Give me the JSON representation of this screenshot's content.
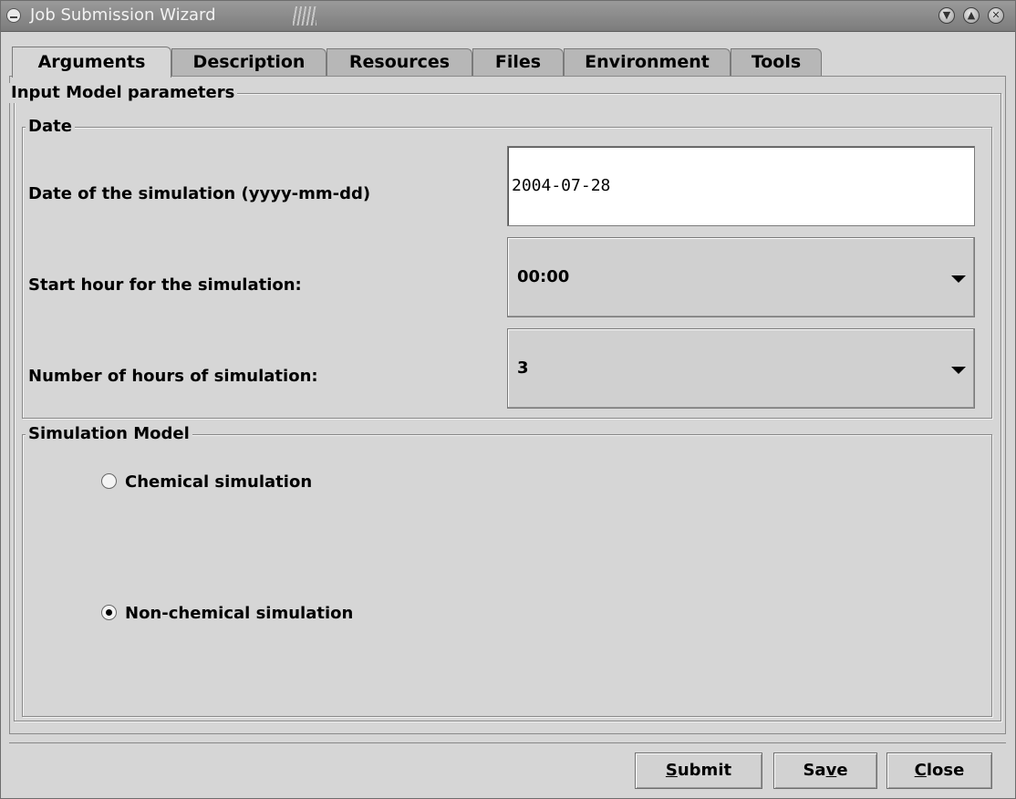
{
  "window": {
    "title": "Job Submission Wizard"
  },
  "tabs": [
    {
      "label": "Arguments",
      "active": true
    },
    {
      "label": "Description",
      "active": false
    },
    {
      "label": "Resources",
      "active": false
    },
    {
      "label": "Files",
      "active": false
    },
    {
      "label": "Environment",
      "active": false
    },
    {
      "label": "Tools",
      "active": false
    }
  ],
  "input_model": {
    "title": "Input Model parameters",
    "date_group": {
      "title": "Date",
      "date_label": "Date of the simulation (yyyy-mm-dd)",
      "date_value": "2004-07-28",
      "start_hour_label": "Start hour for the simulation:",
      "start_hour_value": "00:00",
      "hours_label": "Number of hours of simulation:",
      "hours_value": "3"
    },
    "simulation_model": {
      "title": "Simulation Model",
      "options": [
        {
          "label": "Chemical simulation",
          "selected": false
        },
        {
          "label": "Non-chemical simulation",
          "selected": true
        }
      ]
    }
  },
  "buttons": {
    "submit_mnemonic": "S",
    "submit_rest": "ubmit",
    "save_pre": "Sa",
    "save_mnemonic": "v",
    "save_rest": "e",
    "close_mnemonic": "C",
    "close_rest": "lose"
  }
}
